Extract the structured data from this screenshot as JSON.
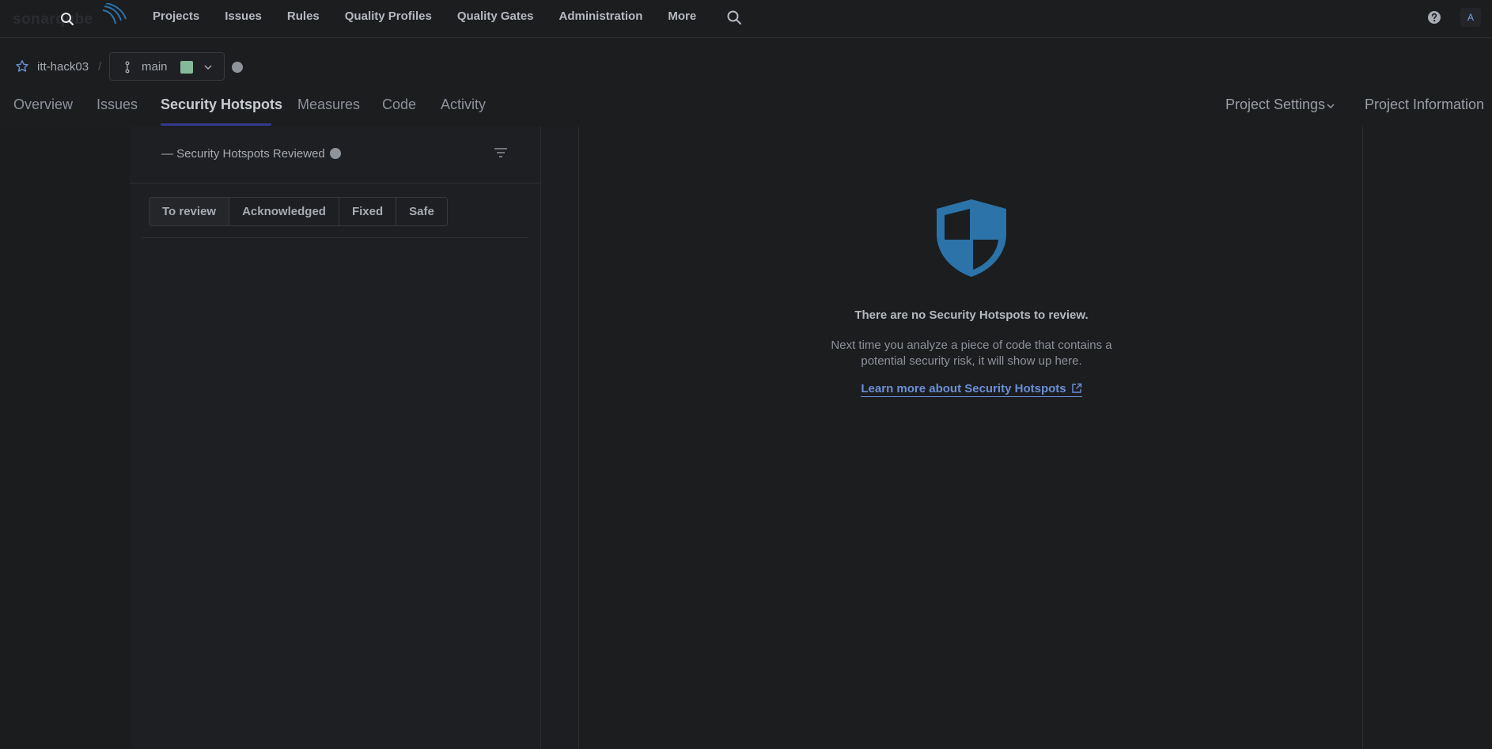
{
  "brand": {
    "logo_text": "sonarqube"
  },
  "topnav": {
    "items": [
      "Projects",
      "Issues",
      "Rules",
      "Quality Profiles",
      "Quality Gates",
      "Administration",
      "More"
    ]
  },
  "user": {
    "avatar_initial": "A"
  },
  "project": {
    "name": "itt-hack03",
    "separator": "/",
    "branch": "main"
  },
  "tabs": {
    "items": [
      "Overview",
      "Issues",
      "Security Hotspots",
      "Measures",
      "Code",
      "Activity"
    ],
    "active": "Security Hotspots",
    "settings_label": "Project Settings",
    "info_label": "Project Information"
  },
  "sidebar": {
    "reviewed_label": "— Security Hotspots Reviewed",
    "status_filters": [
      "To review",
      "Acknowledged",
      "Fixed",
      "Safe"
    ],
    "selected_status": "To review"
  },
  "empty_state": {
    "title": "There are no Security Hotspots to review.",
    "description": "Next time you analyze a piece of code that contains a potential security risk, it will show up here.",
    "link_label": "Learn more about Security Hotspots"
  },
  "colors": {
    "accent_link": "#6b8fd6",
    "shield": "#2b73a8",
    "branch_status": "#86b99a",
    "active_tab_underline": "#313a8f"
  }
}
